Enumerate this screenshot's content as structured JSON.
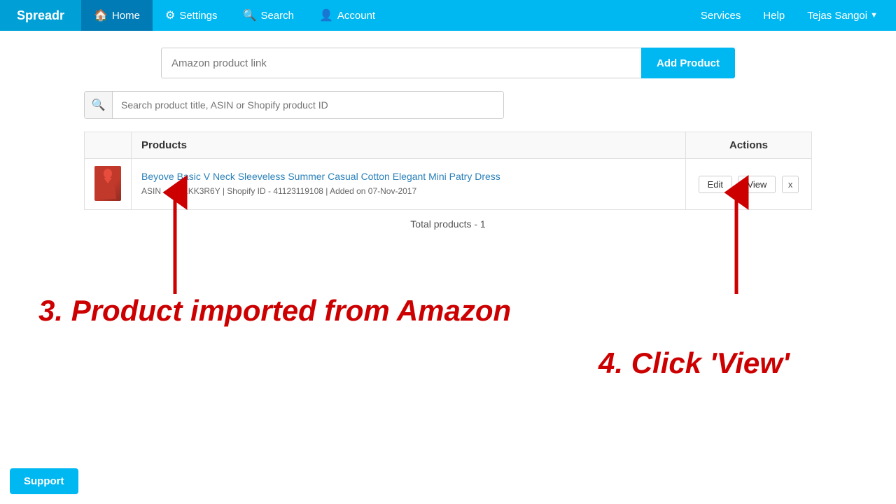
{
  "navbar": {
    "brand": "Spreadr",
    "items": [
      {
        "label": "Home",
        "icon": "🏠",
        "active": true
      },
      {
        "label": "Settings",
        "icon": "⚙"
      },
      {
        "label": "Search",
        "icon": "🔍"
      },
      {
        "label": "Account",
        "icon": "👤"
      }
    ],
    "right_items": [
      {
        "label": "Services"
      },
      {
        "label": "Help"
      },
      {
        "label": "Tejas Sangoi",
        "dropdown": true
      }
    ]
  },
  "add_product": {
    "placeholder": "Amazon product link",
    "button_label": "Add Product"
  },
  "search": {
    "placeholder": "Search product title, ASIN or Shopify product ID"
  },
  "table": {
    "columns": [
      "Products",
      "Actions"
    ],
    "rows": [
      {
        "title": "Beyove Basic V Neck Sleeveless Summer Casual Cotton Elegant Mini Patry Dress",
        "meta": "ASIN - B071KK3R6Y  |  Shopify ID - 41123119108  |  Added on 07-Nov-2017",
        "actions": [
          "Edit",
          "View",
          "x"
        ]
      }
    ]
  },
  "total_products": "Total products - 1",
  "annotations": {
    "text3": "3. Product imported from Amazon",
    "text4": "4. Click 'View'"
  },
  "support": {
    "label": "Support"
  }
}
